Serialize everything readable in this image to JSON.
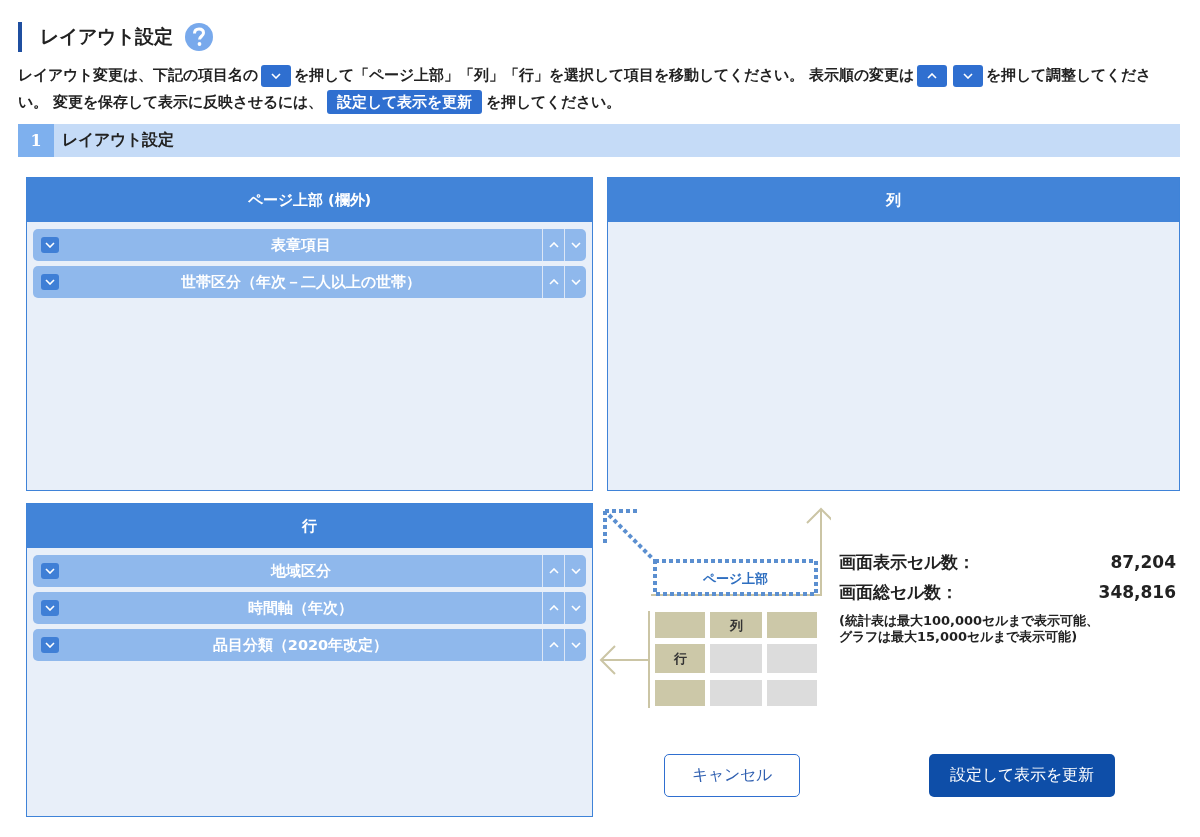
{
  "title": "レイアウト設定",
  "instructions": [
    {
      "kind": "text",
      "text": "レイアウト変更は、下記の項目名の"
    },
    {
      "kind": "caret-down"
    },
    {
      "kind": "text",
      "text": "を押して「ページ上部」「列」「行」を選択して項目を移動してください。 表示順の変更は"
    },
    {
      "kind": "caret-up"
    },
    {
      "kind": "caret-down"
    },
    {
      "kind": "text",
      "text": "を押して調整してください。 変更を保存して表示に反映させるには、"
    },
    {
      "kind": "label",
      "text": "設定して表示を更新"
    },
    {
      "kind": "text",
      "text": "を押してください。"
    }
  ],
  "section": {
    "number": "1",
    "title": "レイアウト設定"
  },
  "panels": [
    {
      "title": "ページ上部 (欄外)",
      "items": [
        "表章項目",
        "世帯区分（年次－二人以上の世帯）"
      ]
    },
    {
      "title": "列"
    },
    {
      "title": "行",
      "items": [
        "地域区分",
        "時間軸（年次）",
        "品目分類（2020年改定）"
      ]
    }
  ],
  "diagram": {
    "page_top": "ページ上部",
    "column": "列",
    "row": "行"
  },
  "counts": [
    {
      "label": "画面表示セル数：",
      "value": "87,204"
    },
    {
      "label": "画面総セル数：",
      "value": "348,816"
    }
  ],
  "note": [
    "(統計表は最大100,000セルまで表示可能、",
    "グラフは最大15,000セルまで表示可能)"
  ],
  "buttons": [
    {
      "kind": "cancel",
      "label": "キャンセル"
    },
    {
      "kind": "submit",
      "label": "設定して表示を更新"
    }
  ]
}
